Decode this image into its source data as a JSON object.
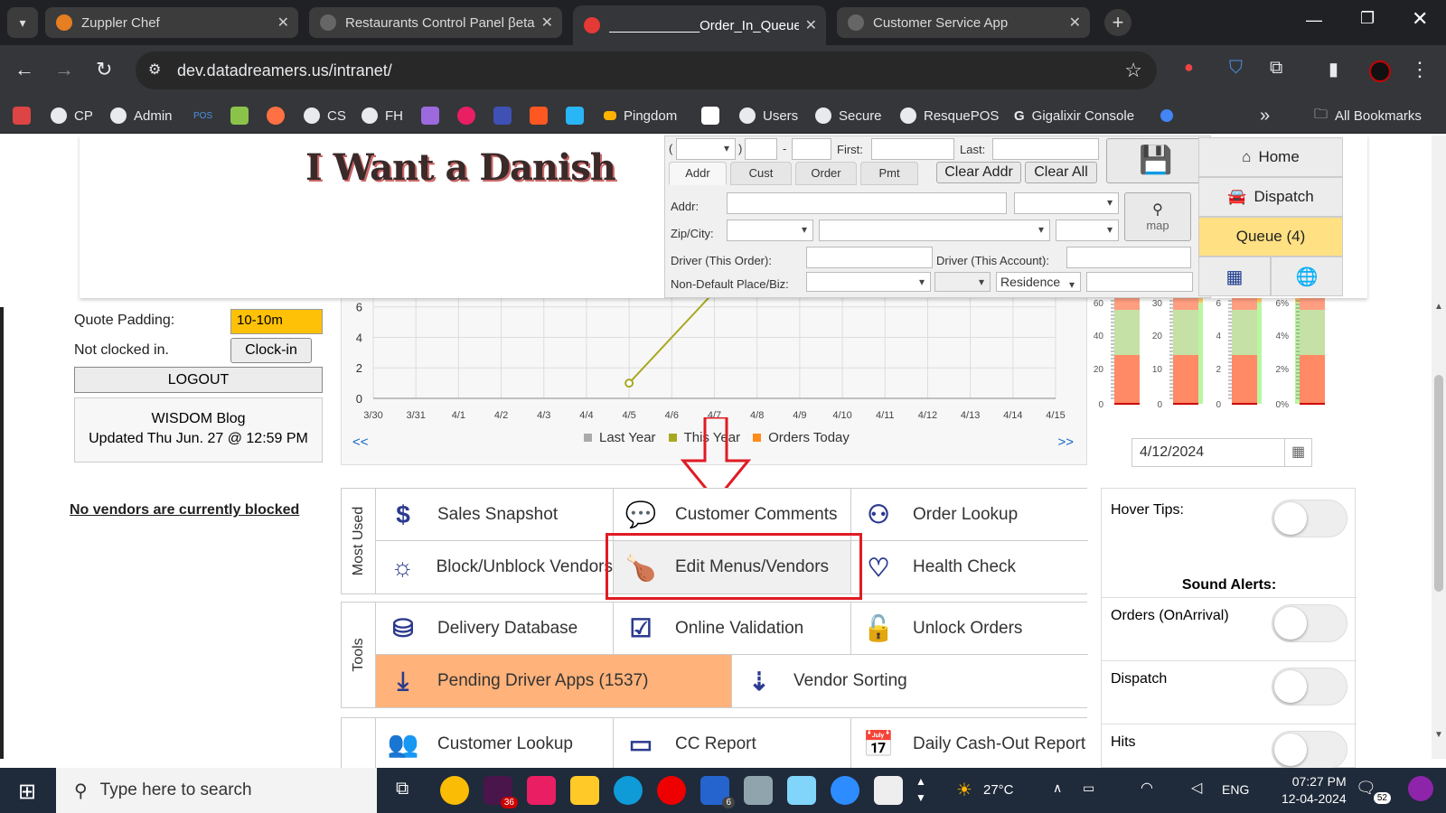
{
  "browser": {
    "tabs": [
      {
        "label": "Zuppler Chef",
        "active": false
      },
      {
        "label": "Restaurants Control Panel βeta",
        "active": false
      },
      {
        "label": "____________Order_In_Queue",
        "active": true
      },
      {
        "label": "Customer Service App",
        "active": false
      }
    ],
    "url": "dev.datadreamers.us/intranet/",
    "bookmarks": [
      "CP",
      "Admin",
      "POS",
      "CS",
      "FH",
      "Pingdom",
      "Users",
      "Secure",
      "ResquePOS",
      "Gigalixir Console"
    ],
    "all_bookmarks": "All Bookmarks",
    "overflow": "»"
  },
  "header": {
    "logo_text": "I Want a Danish"
  },
  "search_panel": {
    "phone_open": "(",
    "phone_close": ")",
    "phone_dash": "-",
    "first_label": "First:",
    "last_label": "Last:",
    "tabs": [
      "Addr",
      "Cust",
      "Order",
      "Pmt"
    ],
    "clear_addr": "Clear Addr",
    "clear_all": "Clear All",
    "addr_label": "Addr:",
    "zip_city_label": "Zip/City:",
    "map_label": "map",
    "driver_this_order_label": "Driver (This Order):",
    "driver_this_account_label": "Driver (This Account):",
    "non_default_label": "Non-Default Place/Biz:",
    "residence_value": "Residence"
  },
  "right_nav": {
    "home": "Home",
    "dispatch": "Dispatch",
    "queue": "Queue (4)",
    "home_icon": "home-icon",
    "dispatch_icon": "car-icon"
  },
  "left_panel": {
    "quote_padding_label": "Quote Padding:",
    "quote_padding_value": "10-10m",
    "clock_status": "Not clocked in.",
    "clock_in_button": "Clock-in",
    "logout": "LOGOUT",
    "wisdom_title": "WISDOM Blog",
    "wisdom_updated": "Updated Thu Jun. 27 @ 12:59 PM",
    "vendors_blocked": "No vendors are currently blocked"
  },
  "chart_data": {
    "type": "line",
    "categories": [
      "3/30",
      "3/31",
      "4/1",
      "4/2",
      "4/3",
      "4/4",
      "4/5",
      "4/6",
      "4/7",
      "4/8",
      "4/9",
      "4/10",
      "4/11",
      "4/12",
      "4/13",
      "4/14",
      "4/15"
    ],
    "yticks": [
      0,
      2,
      4,
      6
    ],
    "ylim": [
      0,
      6
    ],
    "series": [
      {
        "name": "This Year",
        "color": "#a8a820",
        "points": [
          {
            "x": "4/5",
            "y": 1
          },
          {
            "x": "4/7",
            "y": 7
          }
        ]
      }
    ],
    "legend": [
      "Last Year",
      "This Year",
      "Orders Today"
    ],
    "legend_colors": [
      "#aaaaaa",
      "#a8a820",
      "#ff8c1a"
    ],
    "nav_prev": "<<",
    "nav_next": ">>"
  },
  "gauges": {
    "scales": [
      {
        "ticks": [
          "60",
          "40",
          "20",
          "0"
        ]
      },
      {
        "ticks": [
          "30",
          "20",
          "10",
          "0"
        ]
      },
      {
        "ticks": [
          "6",
          "4",
          "2",
          "0"
        ]
      },
      {
        "ticks": [
          "6%",
          "4%",
          "2%",
          "0%"
        ]
      }
    ],
    "date": "4/12/2024"
  },
  "menu": {
    "most_used_label": "Most Used",
    "tools_label": "Tools",
    "most_used": [
      {
        "label": "Sales Snapshot",
        "icon": "dollar-icon"
      },
      {
        "label": "Customer Comments",
        "icon": "comments-icon"
      },
      {
        "label": "Order Lookup",
        "icon": "binoculars-icon"
      },
      {
        "label": "Block/Unblock Vendors",
        "icon": "sun-moon-icon"
      },
      {
        "label": "Edit Menus/Vendors",
        "icon": "drumstick-icon"
      },
      {
        "label": "Health Check",
        "icon": "heartbeat-icon"
      }
    ],
    "tools": [
      {
        "label": "Delivery Database",
        "icon": "database-icon"
      },
      {
        "label": "Online Validation",
        "icon": "check-square-icon"
      },
      {
        "label": "Unlock Orders",
        "icon": "unlock-icon"
      },
      {
        "label": "Pending Driver Apps (1537)",
        "icon": "download-icon"
      },
      {
        "label": "Vendor Sorting",
        "icon": "sort-icon"
      }
    ],
    "third": [
      {
        "label": "Customer Lookup",
        "icon": "users-icon"
      },
      {
        "label": "CC Report",
        "icon": "credit-card-icon"
      },
      {
        "label": "Daily Cash-Out Report",
        "icon": "calendar-icon"
      }
    ]
  },
  "settings": {
    "hover_tips": "Hover Tips:",
    "sound_alerts": "Sound Alerts:",
    "orders_on_arrival": "Orders (OnArrival)",
    "dispatch": "Dispatch",
    "hits": "Hits"
  },
  "taskbar": {
    "search_placeholder": "Type here to search",
    "weather": "27°C",
    "language": "ENG",
    "time": "07:27 PM",
    "date": "12-04-2024",
    "notifications": "52",
    "badge_36": "36",
    "badge_6": "6"
  },
  "colors": {
    "queue_yellow": "#ffe082",
    "pending_orange": "#ffb27a",
    "highlight_red": "#e01b24",
    "icon_blue": "#2b3a8f"
  }
}
